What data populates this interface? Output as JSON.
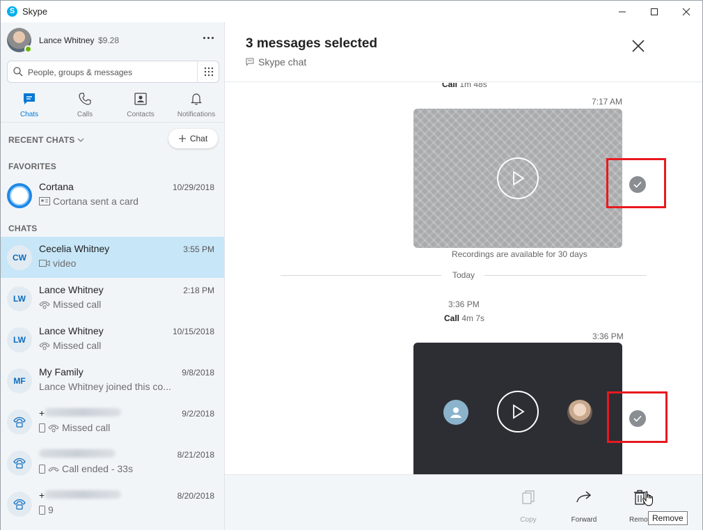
{
  "window": {
    "title": "Skype"
  },
  "profile": {
    "name": "Lance Whitney",
    "credit": "$9.28"
  },
  "search": {
    "placeholder": "People, groups & messages"
  },
  "nav": [
    {
      "label": "Chats",
      "icon": "chat-icon",
      "active": true
    },
    {
      "label": "Calls",
      "icon": "phone-icon"
    },
    {
      "label": "Contacts",
      "icon": "contacts-icon"
    },
    {
      "label": "Notifications",
      "icon": "bell-icon"
    }
  ],
  "recent_label": "RECENT CHATS",
  "new_chat_label": "Chat",
  "favorites_label": "FAVORITES",
  "chats_label": "CHATS",
  "favorites": [
    {
      "name": "Cortana",
      "date": "10/29/2018",
      "preview": "Cortana sent a card",
      "preview_icon": "card-icon"
    }
  ],
  "chats": [
    {
      "initials": "CW",
      "name": "Cecelia Whitney",
      "date": "3:55 PM",
      "preview": "video",
      "preview_icon": "video-icon",
      "selected": true
    },
    {
      "initials": "LW",
      "name": "Lance Whitney",
      "date": "2:18 PM",
      "preview": "Missed call",
      "preview_icon": "missed-call-icon"
    },
    {
      "initials": "LW",
      "name": "Lance Whitney",
      "date": "10/15/2018",
      "preview": "Missed call",
      "preview_icon": "missed-call-icon"
    },
    {
      "initials": "MF",
      "name": "My Family",
      "date": "9/8/2018",
      "preview": "Lance Whitney joined this co...",
      "preview_icon": ""
    },
    {
      "initials": "",
      "name": "+",
      "date": "9/2/2018",
      "preview": "Missed call",
      "preview_icon": "missed-call-icon",
      "phone": true
    },
    {
      "initials": "",
      "name": "",
      "date": "8/21/2018",
      "preview": "Call ended - 33s",
      "preview_icon": "call-ended-icon",
      "phone": true
    },
    {
      "initials": "",
      "name": "+",
      "date": "8/20/2018",
      "preview": "9",
      "preview_icon": "mobile-icon",
      "phone": true
    }
  ],
  "conversation": {
    "title": "3 messages selected",
    "subtitle": "Skype chat",
    "top_call_label": "Call",
    "top_call_duration": "1m 48s",
    "msg1_time": "7:17 AM",
    "recordings_note": "Recordings are available for 30 days",
    "day_divider": "Today",
    "call_time": "3:36 PM",
    "call_label": "Call",
    "call_duration": "4m 7s",
    "msg2_time": "3:36 PM"
  },
  "actions": [
    {
      "label": "Copy",
      "icon": "copy-icon",
      "enabled": false
    },
    {
      "label": "Forward",
      "icon": "forward-icon",
      "enabled": true
    },
    {
      "label": "Remove",
      "icon": "trash-icon",
      "enabled": true
    }
  ],
  "tooltip": "Remove"
}
